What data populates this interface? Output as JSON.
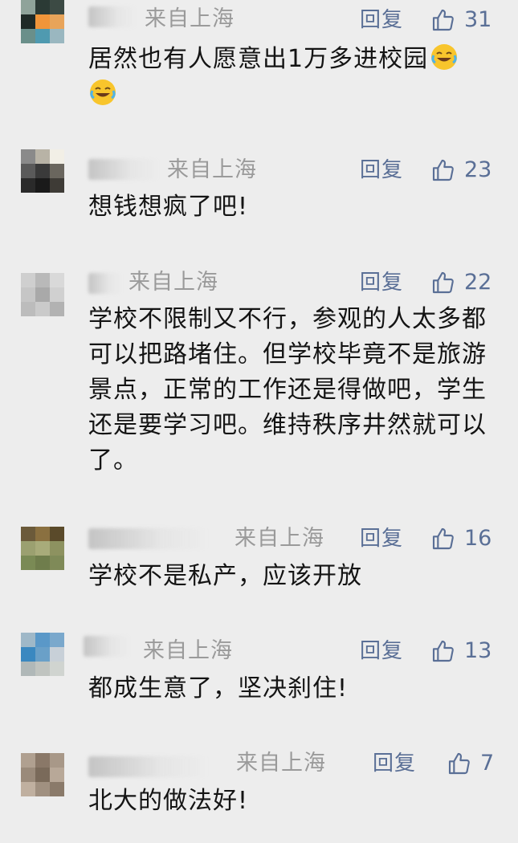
{
  "colors": {
    "background": "#ededed",
    "location": "#9a9a9a",
    "action": "#5a6f96",
    "text": "#141414"
  },
  "comments": [
    {
      "location": "来自上海",
      "reply_label": "回复",
      "likes": "31",
      "text": "居然也有人愿意出1万多进校园",
      "emoji_count": 2,
      "emoji_icon": "laughing-crying-emoji-icon"
    },
    {
      "location": "来自上海",
      "reply_label": "回复",
      "likes": "23",
      "text": "想钱想疯了吧!"
    },
    {
      "location": "来自上海",
      "reply_label": "回复",
      "likes": "22",
      "text": "学校不限制又不行，参观的人太多都可以把路堵住。但学校毕竟不是旅游景点，正常的工作还是得做吧，学生还是要学习吧。维持秩序井然就可以了。"
    },
    {
      "location": "来自上海",
      "reply_label": "回复",
      "likes": "16",
      "text": "学校不是私产，应该开放"
    },
    {
      "location": "来自上海",
      "reply_label": "回复",
      "likes": "13",
      "text": "都成生意了，坚决刹住!"
    },
    {
      "location": "来自上海",
      "reply_label": "回复",
      "likes": "7",
      "text": "北大的做法好!"
    }
  ]
}
